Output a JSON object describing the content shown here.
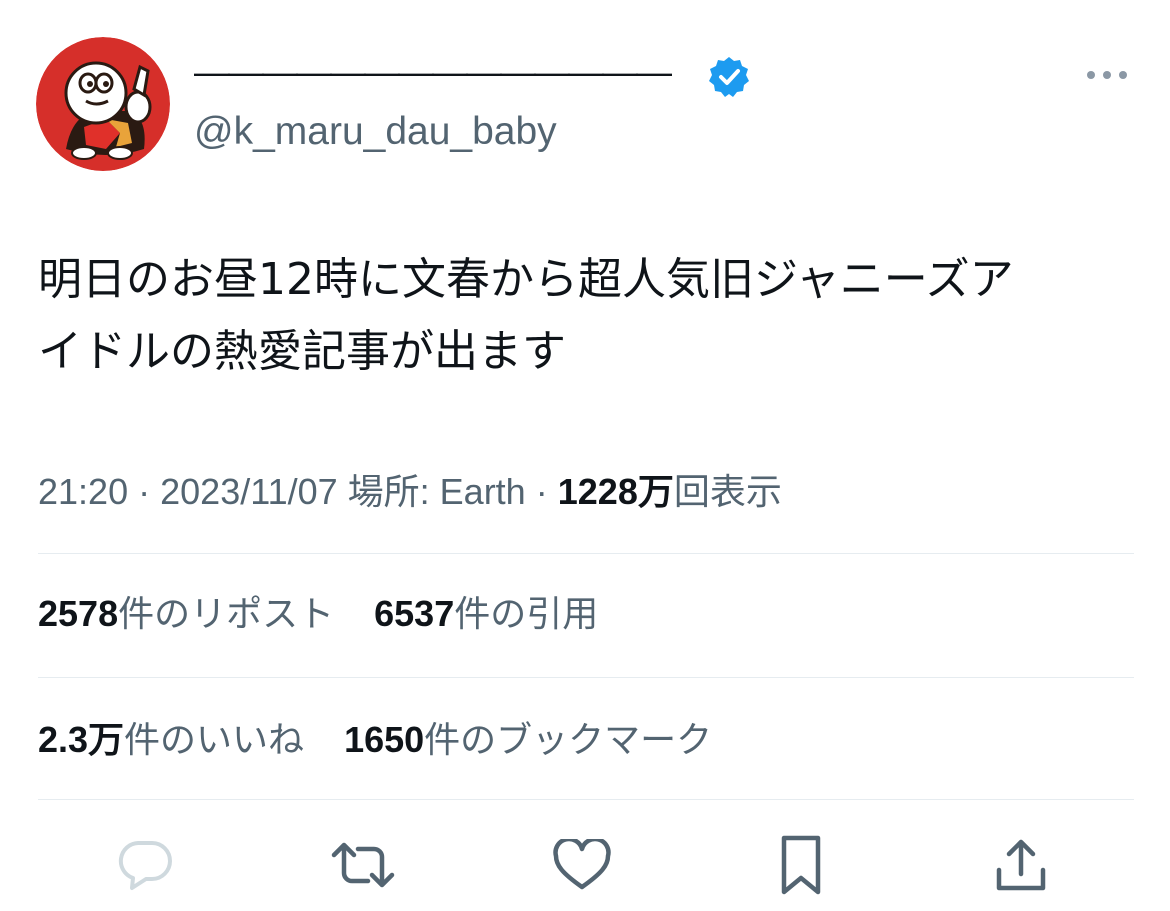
{
  "tweet": {
    "display_name": "——————————————",
    "handle": "@k_maru_dau_baby",
    "text_lines": [
      "明日のお昼12時に文春から超人気旧ジャニーズア",
      "イドルの熱愛記事が出ます"
    ],
    "time": "21:20",
    "separator": "·",
    "date": "2023/11/07",
    "location_label": "場所: Earth",
    "views_count": "1228万",
    "views_label": "回表示"
  },
  "stats": {
    "reposts_count": "2578",
    "reposts_label": "件のリポスト",
    "quotes_count": "6537",
    "quotes_label": "件の引用",
    "likes_count": "2.3万",
    "likes_label": "件のいいね",
    "bookmarks_count": "1650",
    "bookmarks_label": "件のブックマーク"
  },
  "colors": {
    "verified_blue": "#1d9bf0",
    "avatar_red": "#d62f2a",
    "secondary_text": "#536471",
    "primary_text": "#0f1419",
    "action_icon_gray": "#536471",
    "reply_icon_disabled": "#cfd9de"
  },
  "icons": {
    "verified": "verified-badge-icon",
    "more": "more-dots-icon",
    "reply": "reply-icon",
    "repost": "repost-icon",
    "like": "heart-icon",
    "bookmark": "bookmark-icon",
    "share": "share-icon"
  }
}
